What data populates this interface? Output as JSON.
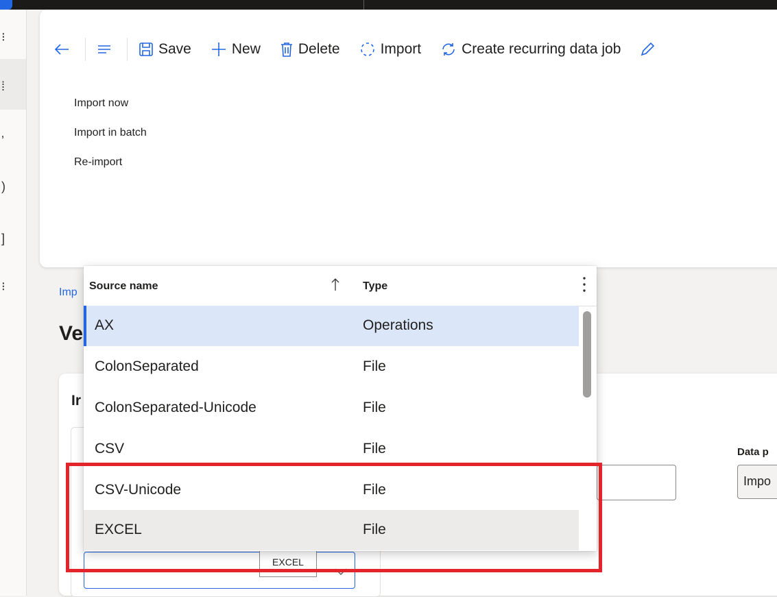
{
  "toolbar": {
    "save_label": "Save",
    "new_label": "New",
    "delete_label": "Delete",
    "import_label": "Import",
    "recurring_label": "Create recurring data job"
  },
  "import_menu": {
    "items": [
      "Import now",
      "Import in batch",
      "Re-import"
    ]
  },
  "page": {
    "breadcrumb": "Imp",
    "title": "Ve",
    "section_title": "Ir",
    "data_project_label": "Data p",
    "data_project_value": "Impo"
  },
  "lookup": {
    "col_source": "Source name",
    "col_type": "Type",
    "rows": [
      {
        "name": "AX",
        "type": "Operations"
      },
      {
        "name": "ColonSeparated",
        "type": "File"
      },
      {
        "name": "ColonSeparated-Unicode",
        "type": "File"
      },
      {
        "name": "CSV",
        "type": "File"
      },
      {
        "name": "CSV-Unicode",
        "type": "File"
      },
      {
        "name": "EXCEL",
        "type": "File"
      }
    ]
  },
  "tooltip": "EXCEL",
  "colors": {
    "accent": "#2266e3",
    "selected_row": "#dbe6f8",
    "hover_row": "#edebe9",
    "annotation": "#e3242b"
  }
}
